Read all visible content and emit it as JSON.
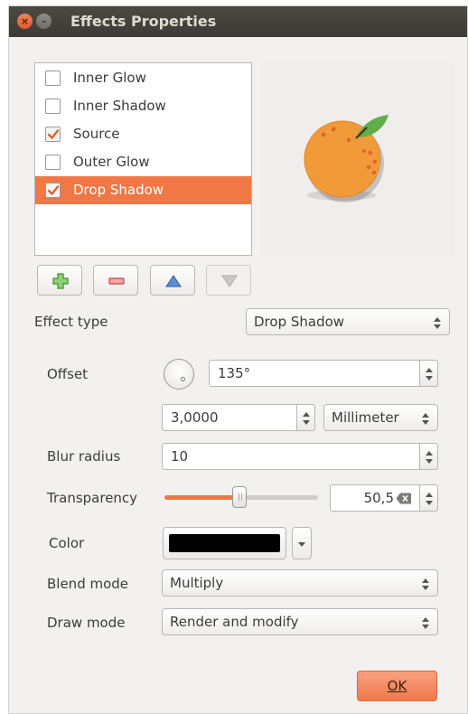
{
  "window": {
    "title": "Effects Properties",
    "close_glyph": "×",
    "minimize_glyph": "–"
  },
  "effects_list": [
    {
      "label": "Inner Glow",
      "checked": false,
      "selected": false
    },
    {
      "label": "Inner Shadow",
      "checked": false,
      "selected": false
    },
    {
      "label": "Source",
      "checked": true,
      "selected": false
    },
    {
      "label": "Outer Glow",
      "checked": false,
      "selected": false
    },
    {
      "label": "Drop Shadow",
      "checked": true,
      "selected": true
    }
  ],
  "preview": {
    "icon": "orange-fruit-preview"
  },
  "toolbar": {
    "add": {
      "icon": "plus-icon"
    },
    "remove": {
      "icon": "minus-icon"
    },
    "move_up": {
      "icon": "arrow-up-icon"
    },
    "move_down": {
      "icon": "arrow-down-icon",
      "enabled": false
    }
  },
  "form": {
    "effect_type_label": "Effect type",
    "effect_type_value": "Drop Shadow",
    "offset_label": "Offset",
    "offset_angle": "135°",
    "offset_distance": "3,0000",
    "offset_unit": "Millimeter",
    "blur_label": "Blur radius",
    "blur_value": "10",
    "transparency_label": "Transparency",
    "transparency_value": "50,5",
    "transparency_fraction": 0.505,
    "color_label": "Color",
    "color_value": "#000000",
    "blend_label": "Blend mode",
    "blend_value": "Multiply",
    "draw_label": "Draw mode",
    "draw_value": "Render and modify"
  },
  "buttons": {
    "ok_label": "OK"
  },
  "colors": {
    "accent": "#f07746",
    "titlebar": "#3c3b37",
    "dialog_bg": "#f2f1f0"
  }
}
